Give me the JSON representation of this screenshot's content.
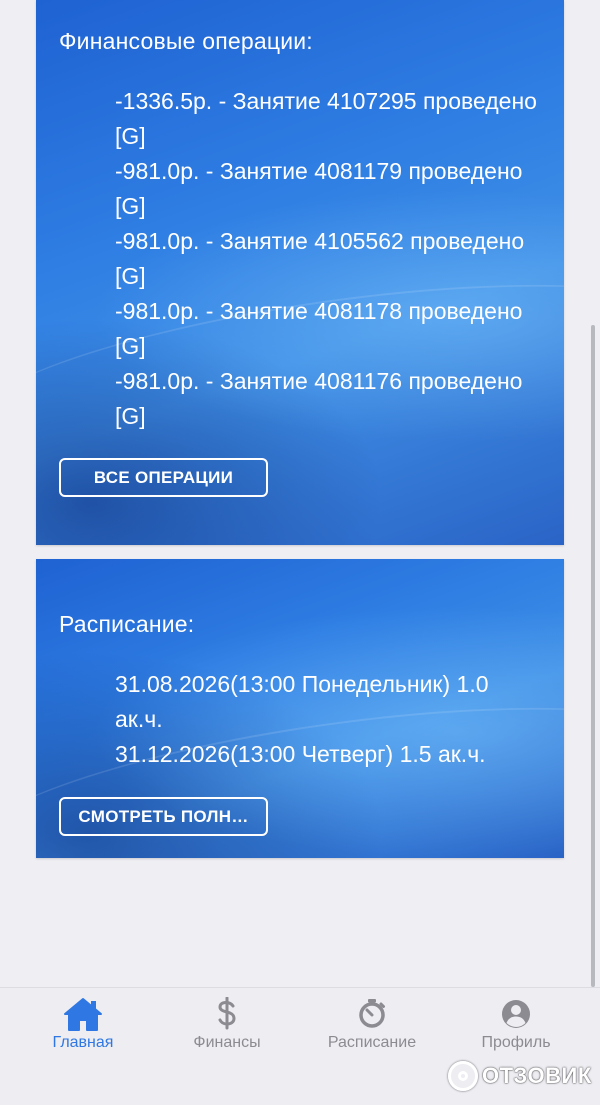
{
  "finance": {
    "title": "Финансовые операции:",
    "operations": [
      "-1336.5р. - Занятие 4107295 проведено [G]",
      "-981.0р. - Занятие 4081179 проведено [G]",
      "-981.0р. - Занятие 4105562 проведено [G]",
      "-981.0р. - Занятие 4081178 проведено [G]",
      "-981.0р. - Занятие 4081176 проведено [G]"
    ],
    "all_button": "ВСЕ ОПЕРАЦИИ"
  },
  "schedule": {
    "title": "Расписание:",
    "items": [
      "31.08.2026(13:00 Понедельник) 1.0 ак.ч.",
      "31.12.2026(13:00 Четверг) 1.5 ак.ч."
    ],
    "full_button": "СМОТРЕТЬ ПОЛН…"
  },
  "nav": {
    "items": [
      {
        "label": "Главная",
        "icon": "home-icon",
        "active": true
      },
      {
        "label": "Финансы",
        "icon": "dollar-icon",
        "active": false
      },
      {
        "label": "Расписание",
        "icon": "timer-icon",
        "active": false
      },
      {
        "label": "Профиль",
        "icon": "profile-icon",
        "active": false
      }
    ]
  },
  "colors": {
    "accent": "#2f78e3",
    "inactive": "#8b8b91",
    "card": "#2f7fe4",
    "background": "#eeeef3"
  },
  "watermark": {
    "text": "ОТЗОВИК"
  }
}
